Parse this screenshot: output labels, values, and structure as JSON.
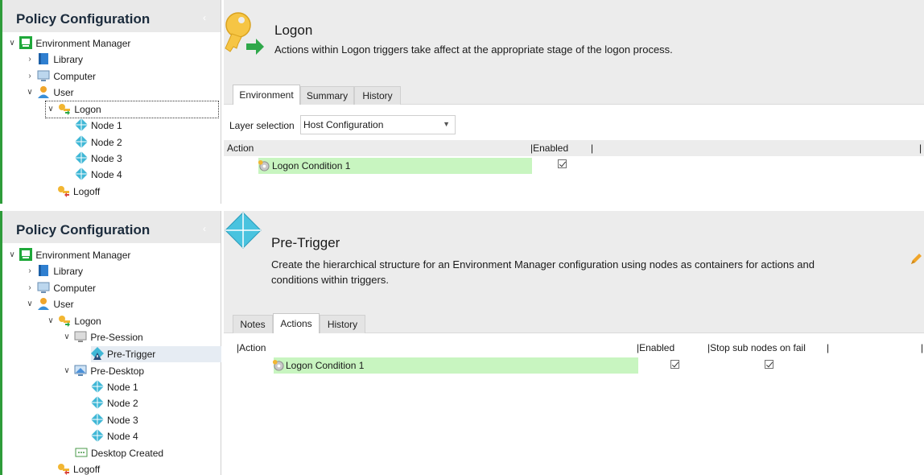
{
  "panel1": {
    "sidebar": {
      "title": "Policy Configuration",
      "collapse_glyph": "‹",
      "tree": [
        {
          "label": "Environment Manager",
          "icon": "em-icon",
          "expander": "∨"
        },
        {
          "label": "Library",
          "icon": "library-icon",
          "expander": "›"
        },
        {
          "label": "Computer",
          "icon": "computer-icon",
          "expander": "›"
        },
        {
          "label": "User",
          "icon": "user-icon",
          "expander": "∨"
        },
        {
          "label": "Logon",
          "icon": "key-icon",
          "expander": "∨"
        },
        {
          "label": "Node 1",
          "icon": "node-icon",
          "expander": ""
        },
        {
          "label": "Node 2",
          "icon": "node-icon",
          "expander": ""
        },
        {
          "label": "Node 3",
          "icon": "node-icon",
          "expander": ""
        },
        {
          "label": "Node 4",
          "icon": "node-icon",
          "expander": ""
        },
        {
          "label": "Logoff",
          "icon": "key-icon",
          "expander": ""
        }
      ]
    },
    "header": {
      "title": "Logon",
      "description": "Actions within Logon triggers take affect at the appropriate stage of the logon process."
    },
    "tabs": [
      "Environment",
      "Summary",
      "History"
    ],
    "layer_label": "Layer selection",
    "layer_value": "Host Configuration",
    "columns": [
      "Action",
      "|Enabled",
      "|"
    ],
    "row": {
      "action": "Logon Condition 1",
      "enabled": true
    }
  },
  "panel2": {
    "sidebar": {
      "title": "Policy Configuration",
      "collapse_glyph": "‹",
      "tree": [
        {
          "label": "Environment Manager",
          "icon": "em-icon",
          "expander": "∨"
        },
        {
          "label": "Library",
          "icon": "library-icon",
          "expander": "›"
        },
        {
          "label": "Computer",
          "icon": "computer-icon",
          "expander": "›"
        },
        {
          "label": "User",
          "icon": "user-icon",
          "expander": "∨"
        },
        {
          "label": "Logon",
          "icon": "key-icon",
          "expander": "∨"
        },
        {
          "label": "Pre-Session",
          "icon": "session-icon",
          "expander": "∨"
        },
        {
          "label": "Pre-Trigger",
          "icon": "pretrigger-icon",
          "expander": ""
        },
        {
          "label": "Pre-Desktop",
          "icon": "desktop-icon",
          "expander": "∨"
        },
        {
          "label": "Node 1",
          "icon": "node-icon",
          "expander": ""
        },
        {
          "label": "Node 2",
          "icon": "node-icon",
          "expander": ""
        },
        {
          "label": "Node 3",
          "icon": "node-icon",
          "expander": ""
        },
        {
          "label": "Node 4",
          "icon": "node-icon",
          "expander": ""
        },
        {
          "label": "Desktop Created",
          "icon": "desktop-created-icon",
          "expander": ""
        },
        {
          "label": "Logoff",
          "icon": "key-icon",
          "expander": ""
        }
      ]
    },
    "header": {
      "title": "Pre-Trigger",
      "description_line1": "Create the hierarchical structure for an Environment Manager configuration using nodes as containers for actions and",
      "description_line2": "conditions within triggers."
    },
    "tabs": [
      "Notes",
      "Actions",
      "History"
    ],
    "columns": [
      "|Action",
      "|Enabled",
      "|Stop sub nodes on fail",
      "|",
      "|"
    ],
    "row": {
      "action": "Logon Condition 1",
      "enabled": true,
      "stop_sub_nodes": true
    }
  },
  "colors": {
    "accent_green": "#2e9c3a",
    "row_highlight": "#c8f5c0",
    "node_blue": "#3fb7d6"
  }
}
